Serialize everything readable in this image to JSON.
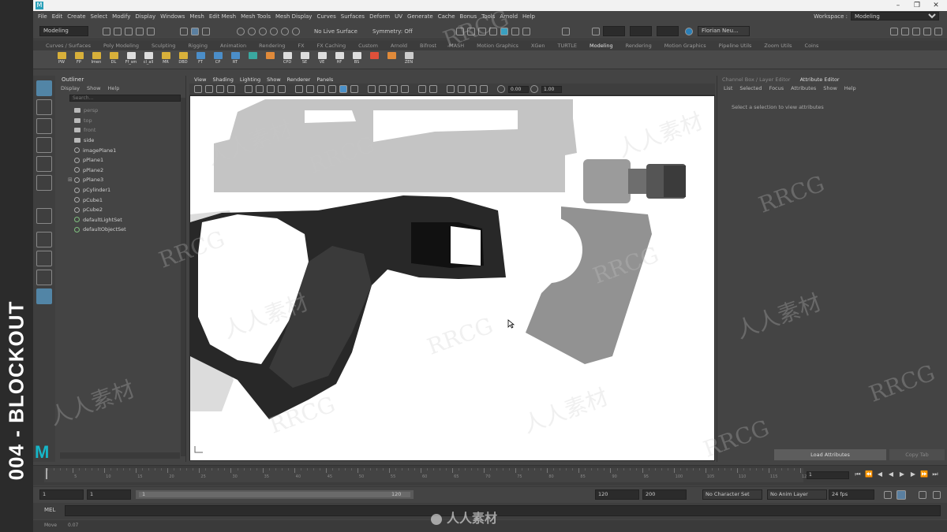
{
  "app": {
    "accent": "#16b6c8",
    "logo_glyph": "M",
    "overlay_caption": "004 - BLOCKOUT",
    "window_buttons": [
      "–",
      "❐",
      "✕"
    ]
  },
  "menubar": {
    "items": [
      "File",
      "Edit",
      "Create",
      "Select",
      "Modify",
      "Display",
      "Windows",
      "Mesh",
      "Edit Mesh",
      "Mesh Tools",
      "Mesh Display",
      "Curves",
      "Surfaces",
      "Deform",
      "UV",
      "Generate",
      "Cache",
      "Bonus",
      "Tools",
      "Arnold",
      "Help"
    ],
    "workspace_label": "Workspace :",
    "workspace_value": "Modeling"
  },
  "statusline": {
    "mode": "Modeling",
    "live_surface": "No Live Surface",
    "symmetry": "Symmetry: Off",
    "user": "Florian Neu..."
  },
  "shelf": {
    "tabs": [
      "Curves / Surfaces",
      "Poly Modeling",
      "Sculpting",
      "Rigging",
      "Animation",
      "Rendering",
      "FX",
      "FX Caching",
      "Custom",
      "Arnold",
      "Bifrost",
      "MASH",
      "Motion Graphics",
      "XGen",
      "TURTLE",
      "Modeling",
      "Rendering",
      "Motion Graphics",
      "Pipeline Utils",
      "Zoom Utils",
      "Coins"
    ],
    "active_tab": "Modeling",
    "buttons": [
      "PW",
      "FP",
      "Imen",
      "DL",
      "Ff_sm",
      "cl_all",
      "MR",
      "DBD",
      "FT",
      "CP",
      "RT",
      "",
      "",
      "CPD",
      "SE",
      "VE",
      "HF",
      "BS",
      "",
      "",
      "ZEN"
    ]
  },
  "outliner": {
    "title": "Outliner",
    "menu": [
      "Display",
      "Show",
      "Help"
    ],
    "search_placeholder": "Search...",
    "items": [
      {
        "label": "persp",
        "icon": "camera-icon",
        "dim": true
      },
      {
        "label": "top",
        "icon": "camera-icon",
        "dim": true
      },
      {
        "label": "front",
        "icon": "camera-icon",
        "dim": true
      },
      {
        "label": "side",
        "icon": "camera-icon",
        "dim": false
      },
      {
        "label": "imagePlane1",
        "icon": "mesh-icon",
        "dim": false
      },
      {
        "label": "pPlane1",
        "icon": "mesh-icon",
        "dim": false
      },
      {
        "label": "pPlane2",
        "icon": "mesh-icon",
        "dim": false
      },
      {
        "label": "pPlane3",
        "icon": "mesh-icon",
        "dim": false,
        "expandable": true
      },
      {
        "label": "pCylinder1",
        "icon": "mesh-icon",
        "dim": false
      },
      {
        "label": "pCube1",
        "icon": "mesh-icon",
        "dim": false
      },
      {
        "label": "pCube2",
        "icon": "mesh-icon",
        "dim": false
      },
      {
        "label": "defaultLightSet",
        "icon": "set-icon",
        "dim": false
      },
      {
        "label": "defaultObjectSet",
        "icon": "set-icon",
        "dim": false
      }
    ]
  },
  "viewport": {
    "menu": [
      "View",
      "Shading",
      "Lighting",
      "Show",
      "Renderer",
      "Panels"
    ],
    "field1": "0.00",
    "field2": "1.00"
  },
  "attribute_editor": {
    "tabs": [
      "Channel Box / Layer Editor",
      "Attribute Editor"
    ],
    "active_tab": "Attribute Editor",
    "menu": [
      "List",
      "Selected",
      "Focus",
      "Attributes",
      "Show",
      "Help"
    ],
    "message": "Select a selection to view attributes",
    "load_button": "Load Attributes",
    "copy_button": "Copy Tab"
  },
  "timeline": {
    "tick_labels": [
      "5",
      "10",
      "15",
      "20",
      "25",
      "30",
      "35",
      "40",
      "45",
      "50",
      "55",
      "60",
      "65",
      "70",
      "75",
      "80",
      "85",
      "90",
      "95",
      "100",
      "105",
      "110",
      "115",
      "120"
    ],
    "current_frame": "1"
  },
  "range": {
    "start": "1",
    "playback_start": "1",
    "slider_start": "1",
    "slider_end": "120",
    "playback_end": "120",
    "end": "200",
    "character_set": "No Character Set",
    "anim_layer": "No Anim Layer",
    "fps": "24 fps"
  },
  "command": {
    "label": "MEL"
  },
  "helpline": {
    "left": "Move",
    "mid": "0.07"
  },
  "watermarks": {
    "brand": "RRCG",
    "cn": "人人素材",
    "footer": "人人素材"
  }
}
